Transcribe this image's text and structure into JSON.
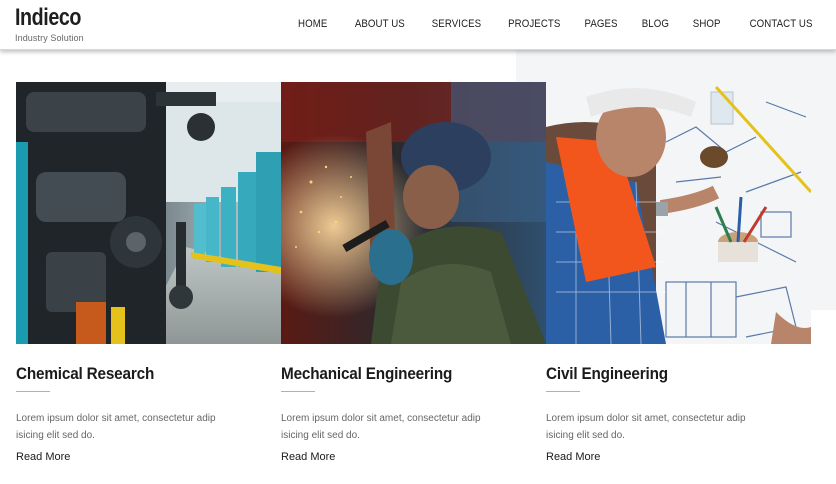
{
  "brand": {
    "name": "Indieco",
    "tagline": "Industry Solution"
  },
  "nav": {
    "items": [
      {
        "label": "HOME"
      },
      {
        "label": "ABOUT US"
      },
      {
        "label": "SERVICES"
      },
      {
        "label": "PROJECTS"
      },
      {
        "label": "PAGES"
      },
      {
        "label": "BLOG"
      },
      {
        "label": "SHOP"
      },
      {
        "label": "CONTACT US"
      }
    ]
  },
  "cards": [
    {
      "title": "Chemical Research",
      "description": "Lorem ipsum dolor sit amet, consectetur adip isicing elit sed do.",
      "link": "Read More",
      "image": "chemical-plant-pipes-photo"
    },
    {
      "title": "Mechanical Engineering",
      "description": "Lorem ipsum dolor sit amet, consectetur adip isicing elit sed do.",
      "link": "Read More",
      "image": "welder-with-sparks-photo"
    },
    {
      "title": "Civil Engineering",
      "description": "Lorem ipsum dolor sit amet, consectetur adip isicing elit sed do.",
      "link": "Read More",
      "image": "engineer-drawing-blueprints-photo"
    }
  ]
}
